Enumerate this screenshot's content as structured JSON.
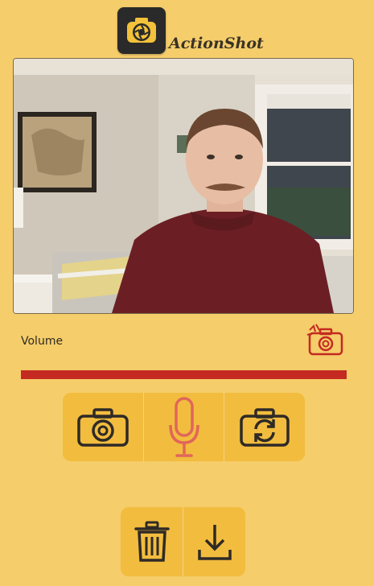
{
  "app": {
    "name": "ActionShot"
  },
  "controls": {
    "volume_label": "Volume",
    "volume_level": 1.0
  },
  "icons": {
    "logo": "camera-aperture-icon",
    "snap_indicator": "camera-flash-icon",
    "photo": "camera-icon",
    "voice": "microphone-icon",
    "switch": "camera-switch-icon",
    "delete": "trash-icon",
    "download": "download-icon"
  },
  "colors": {
    "background": "#f5cd6a",
    "button_group": "#f2bc3e",
    "volume_bar": "#c42a22",
    "mic_active": "#e0665a",
    "icon_dark": "#2e2a26"
  }
}
